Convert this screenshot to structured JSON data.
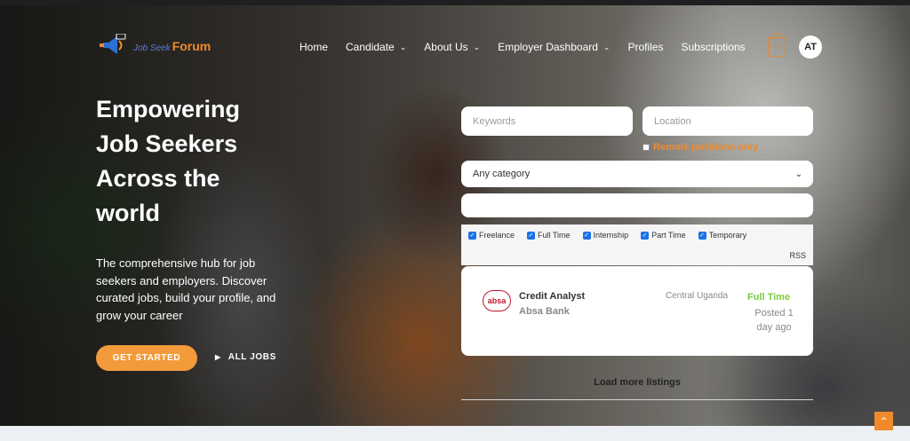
{
  "header": {
    "logo_tagline": "Job Seek",
    "logo_brand": "Forum",
    "nav": [
      {
        "label": "Home",
        "dropdown": false
      },
      {
        "label": "Candidate",
        "dropdown": true
      },
      {
        "label": "About Us",
        "dropdown": true
      },
      {
        "label": "Employer Dashboard",
        "dropdown": true
      },
      {
        "label": "Profiles",
        "dropdown": false
      },
      {
        "label": "Subscriptions",
        "dropdown": false
      }
    ],
    "cart_count": "0",
    "avatar_initials": "AT"
  },
  "hero": {
    "headline": "Empowering Job Seekers Across the world",
    "subtext": "The comprehensive hub for job seekers and employers. Discover curated jobs, build your profile, and grow your career",
    "cta_primary": "GET STARTED",
    "cta_secondary": "ALL JOBS"
  },
  "search": {
    "keywords_placeholder": "Keywords",
    "location_placeholder": "Location",
    "remote_label": "Remote positions only",
    "category_value": "Any category",
    "job_types": [
      "Freelance",
      "Full Time",
      "Internship",
      "Part Time",
      "Temporary"
    ],
    "rss_label": "RSS"
  },
  "listings": [
    {
      "logo_text": "absa",
      "title": "Credit Analyst",
      "company": "Absa Bank",
      "location": "Central Uganda",
      "type": "Full Time",
      "posted": "Posted 1 day ago"
    }
  ],
  "load_more": "Load more listings",
  "colors": {
    "accent": "#f08a2a",
    "full_time": "#7ac943",
    "checkbox": "#1a73e8"
  }
}
